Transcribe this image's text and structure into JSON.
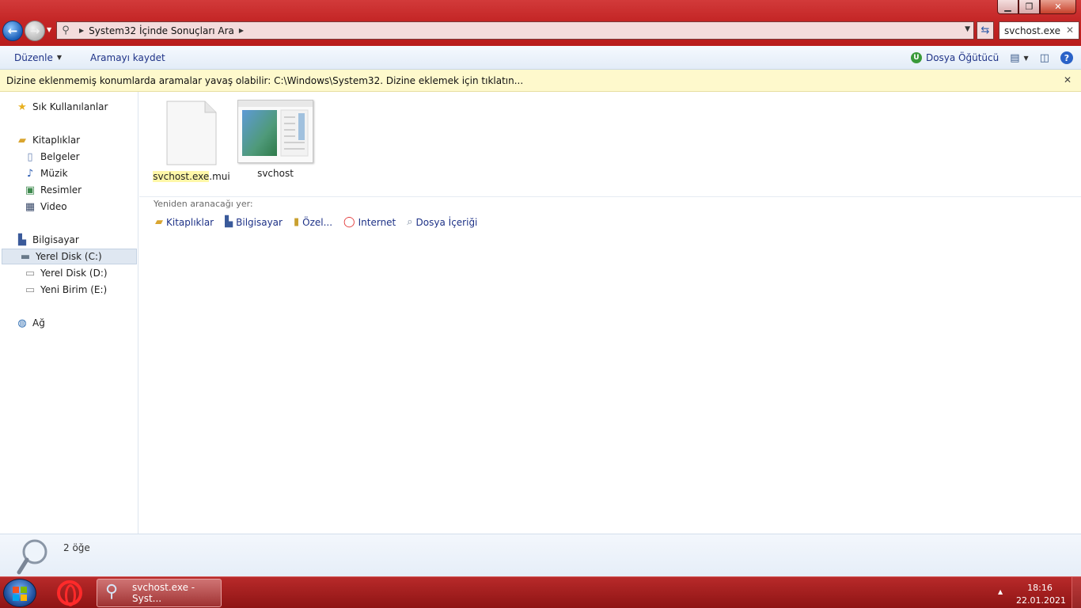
{
  "window": {
    "controls": {
      "minimize": "▁",
      "maximize": "❐",
      "close": "✕"
    }
  },
  "address": {
    "breadcrumb": "System32 İçinde Sonuçları Ara"
  },
  "search": {
    "value": "svchost.exe"
  },
  "toolbar": {
    "organize": "Düzenle",
    "save_search": "Aramayı kaydet",
    "file_guide": "Dosya Öğütücü"
  },
  "infobar": {
    "message": "Dizine eklenmemiş konumlarda aramalar yavaş olabilir: C:\\Windows\\System32. Dizine eklemek için tıklatın..."
  },
  "navpane": {
    "favorites": "Sık Kullanılanlar",
    "libraries": "Kitaplıklar",
    "documents": "Belgeler",
    "music": "Müzik",
    "pictures": "Resimler",
    "videos": "Video",
    "computer": "Bilgisayar",
    "disk_c": "Yerel Disk (C:)",
    "disk_d": "Yerel Disk (D:)",
    "disk_e": "Yeni Birim (E:)",
    "network": "Ağ"
  },
  "results": {
    "files": [
      {
        "highlight": "svchost.exe",
        "rest": ".mui"
      },
      {
        "name": "svchost"
      }
    ],
    "search_again_label": "Yeniden aranacağı yer:",
    "locations": {
      "libraries": "Kitaplıklar",
      "computer": "Bilgisayar",
      "custom": "Özel...",
      "internet": "Internet",
      "file_contents": "Dosya İçeriği"
    }
  },
  "details": {
    "count": "2 öğe"
  },
  "taskbar": {
    "explorer_task": "svchost.exe - Syst...",
    "time": "18:16",
    "date": "22.01.2021"
  },
  "colors": {
    "title_red": "#c42626",
    "link_blue": "#1e3287",
    "info_yellow": "#fef9cc",
    "highlight_yellow": "#fff7a8"
  }
}
